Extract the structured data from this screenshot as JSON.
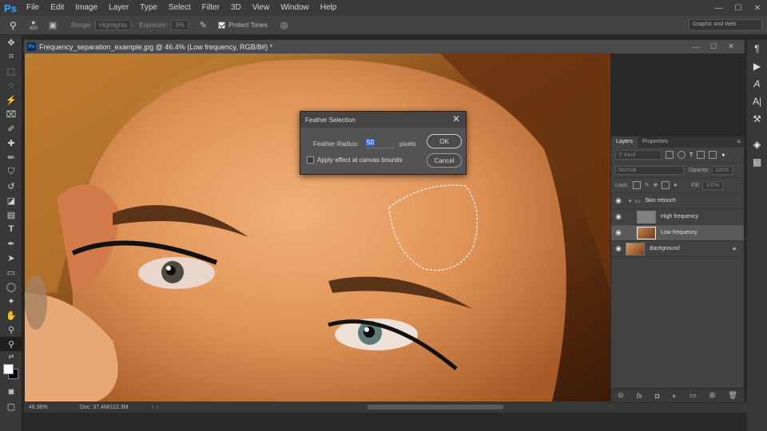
{
  "app": {
    "logo": "Ps"
  },
  "menu": [
    "File",
    "Edit",
    "Image",
    "Layer",
    "Type",
    "Select",
    "Filter",
    "3D",
    "View",
    "Window",
    "Help"
  ],
  "window_controls": {
    "minimize": "—",
    "maximize": "☐",
    "close": "✕"
  },
  "options": {
    "brush_size": "400",
    "range_label": "Range:",
    "range_value": "Highlights",
    "exposure_label": "Exposure:",
    "exposure_value": "3%",
    "protect_tones": "Protect Tones",
    "protect_tones_checked": true,
    "workspace": "Graphic and Web"
  },
  "document": {
    "tab_title": "Frequency_separation_example.jpg @ 46.4% (Low frequency, RGB/8#) *",
    "zoom": "46.36%",
    "doc_size": "Doc: 37.4M/112.3M"
  },
  "dialog": {
    "title": "Feather Selection",
    "radius_label": "Feather Radius:",
    "radius_value": "50",
    "unit": "pixels",
    "checkbox_label": "Apply effect at canvas bounds",
    "ok": "OK",
    "cancel": "Cancel"
  },
  "layers_panel": {
    "tabs": [
      "Layers",
      "Properties"
    ],
    "kind": "Kind",
    "blend_mode": "Normal",
    "opacity_label": "Opacity:",
    "opacity_value": "100%",
    "lock_label": "Lock:",
    "fill_label": "Fill:",
    "fill_value": "100%",
    "layers": [
      {
        "name": "Skin retouch",
        "type": "group"
      },
      {
        "name": "High frequency",
        "type": "layer"
      },
      {
        "name": "Low frequency",
        "type": "layer",
        "selected": true
      },
      {
        "name": "Background",
        "type": "layer",
        "locked": true
      }
    ]
  },
  "colors": {
    "accent": "#31a8ff",
    "panel": "#424242",
    "selected_layer": "#5a5a5a"
  }
}
